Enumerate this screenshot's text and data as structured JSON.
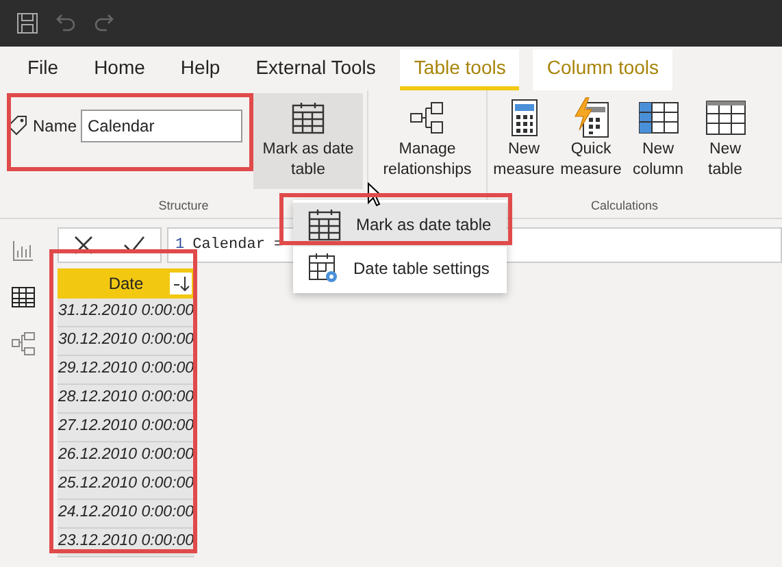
{
  "tabs": [
    {
      "label": "File",
      "kind": "standard",
      "selected": false
    },
    {
      "label": "Home",
      "kind": "standard",
      "selected": false
    },
    {
      "label": "Help",
      "kind": "standard",
      "selected": false
    },
    {
      "label": "External Tools",
      "kind": "standard",
      "selected": false
    },
    {
      "label": "Table tools",
      "kind": "contextual",
      "selected": true
    },
    {
      "label": "Column tools",
      "kind": "contextual",
      "selected": false
    }
  ],
  "ribbon": {
    "name_field": {
      "label": "Name",
      "value": "Calendar"
    },
    "groups": [
      {
        "label": "Structure",
        "buttons": [
          {
            "label": "Mark as date table",
            "kind": "date-table",
            "pressed": true
          }
        ]
      },
      {
        "buttons": [
          {
            "label": "Manage relationships",
            "kind": "relationships",
            "pressed": false
          }
        ]
      },
      {
        "label": "Calculations",
        "buttons": [
          {
            "label": "New measure",
            "kind": "measure",
            "pressed": false
          },
          {
            "label": "Quick measure",
            "kind": "quick",
            "pressed": false
          },
          {
            "label": "New column",
            "kind": "column",
            "pressed": false
          },
          {
            "label": "New table",
            "kind": "table",
            "pressed": false
          }
        ]
      }
    ]
  },
  "menu": [
    {
      "label": "Mark as date table",
      "selected": true
    },
    {
      "label": "Date table settings",
      "selected": false
    }
  ],
  "view_rail": [
    {
      "selected": false
    },
    {
      "selected": true
    },
    {
      "selected": false
    }
  ],
  "formula_bar": {
    "line": "1",
    "text": "Calendar ="
  },
  "table": {
    "column": {
      "label": "Date",
      "selected": true
    },
    "rows": [
      "31.12.2010 0:00:00",
      "30.12.2010 0:00:00",
      "29.12.2010 0:00:00",
      "28.12.2010 0:00:00",
      "27.12.2010 0:00:00",
      "26.12.2010 0:00:00",
      "25.12.2010 0:00:00",
      "24.12.2010 0:00:00",
      "23.12.2010 0:00:00"
    ]
  }
}
